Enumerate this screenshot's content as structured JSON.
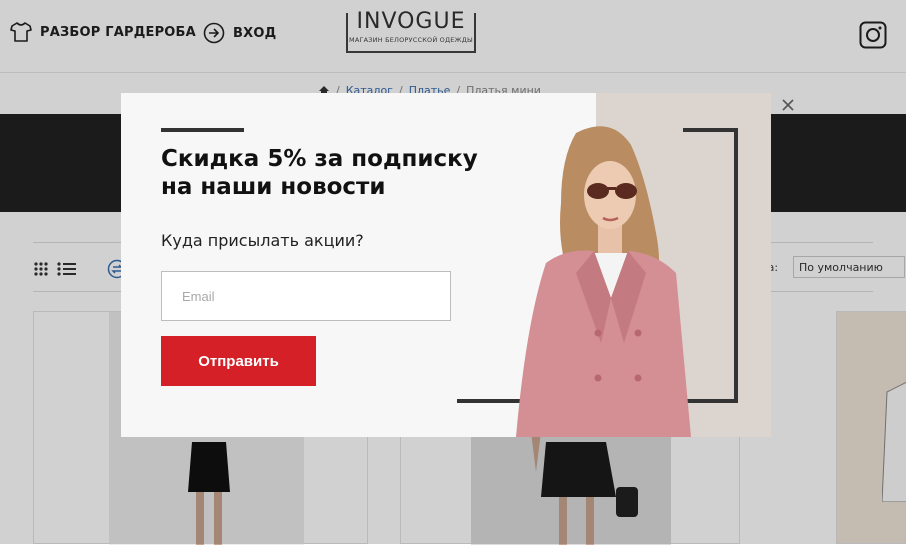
{
  "header": {
    "wardrobe_label": "РАЗБОР ГАРДЕРОБА",
    "login_label": "ВХОД",
    "logo_title": "INVOGUE",
    "logo_subtitle": "МАГАЗИН БЕЛОРУССКОЙ ОДЕЖДЫ"
  },
  "breadcrumb": [
    "Каталог",
    "Платье",
    "Платья мини"
  ],
  "toolbar": {
    "sort_label": "ка:",
    "sort_value": "По умолчанию"
  },
  "popup": {
    "title_line1": "Скидка 5% за подписку",
    "title_line2": "на наши новости",
    "subtitle": "Куда присылать акции?",
    "email_placeholder": "Email",
    "submit_label": "Отправить"
  },
  "colors": {
    "accent_red": "#d42026",
    "dark_band": "#222222",
    "coat_pink": "#d48f95"
  }
}
